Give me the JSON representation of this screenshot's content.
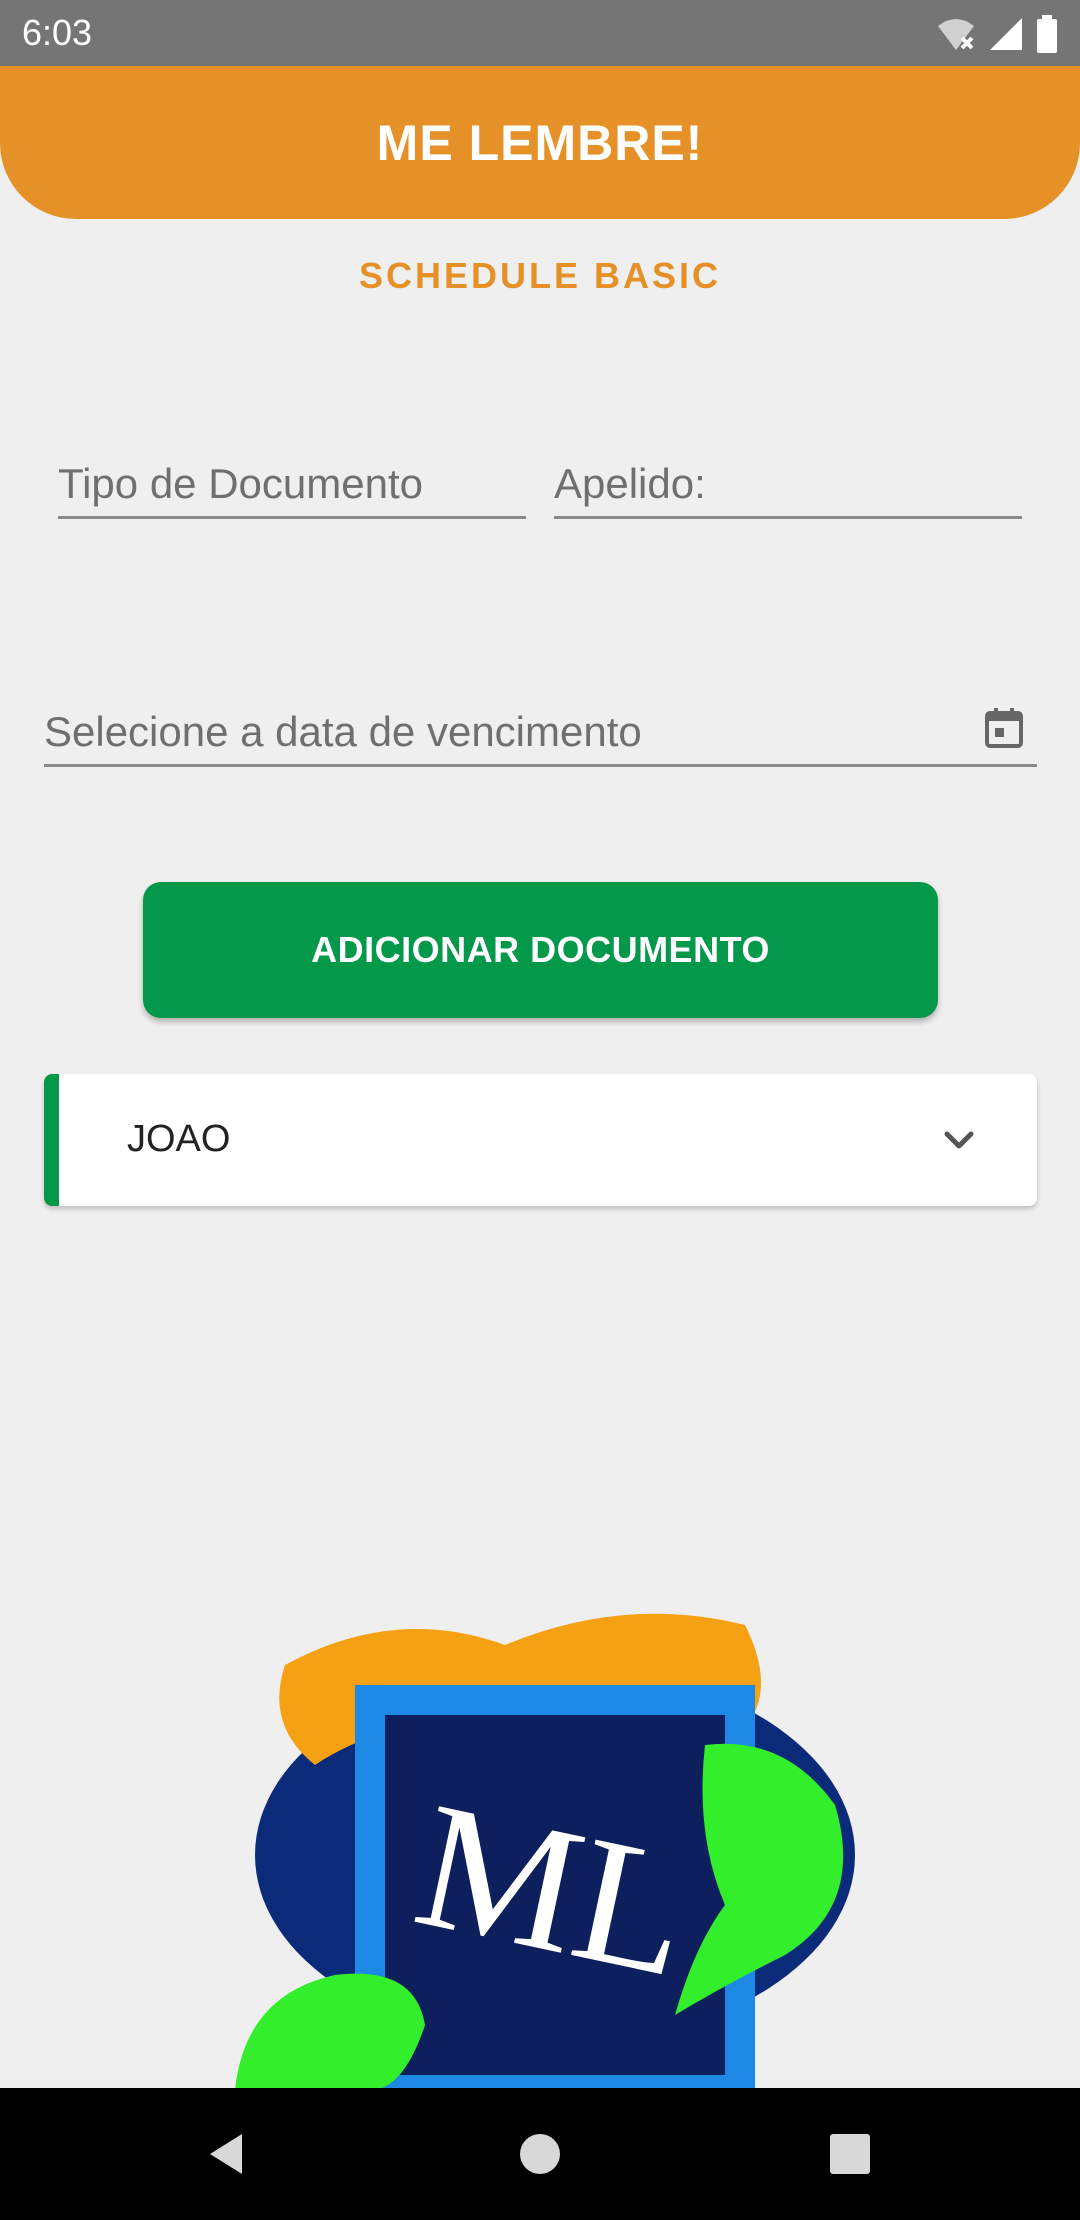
{
  "status_bar": {
    "time": "6:03",
    "icons": [
      "wifi-off-icon",
      "signal-icon",
      "battery-icon"
    ]
  },
  "header": {
    "title": "ME LEMBRE!"
  },
  "subtitle": "SCHEDULE BASIC",
  "form": {
    "document_type_placeholder": "Tipo de Documento",
    "nickname_placeholder": "Apelido:",
    "due_date_placeholder": "Selecione a data de vencimento"
  },
  "add_button": {
    "label": "ADICIONAR DOCUMENTO"
  },
  "list": {
    "items": [
      {
        "title": "JOAO",
        "icon": "chevron-down-icon"
      }
    ]
  },
  "logo": {
    "text": "ML"
  },
  "colors": {
    "accent": "#e69128",
    "primary": "#03984a",
    "background": "#efefef"
  },
  "nav_bar": {
    "buttons": [
      "back",
      "home",
      "recents"
    ]
  }
}
